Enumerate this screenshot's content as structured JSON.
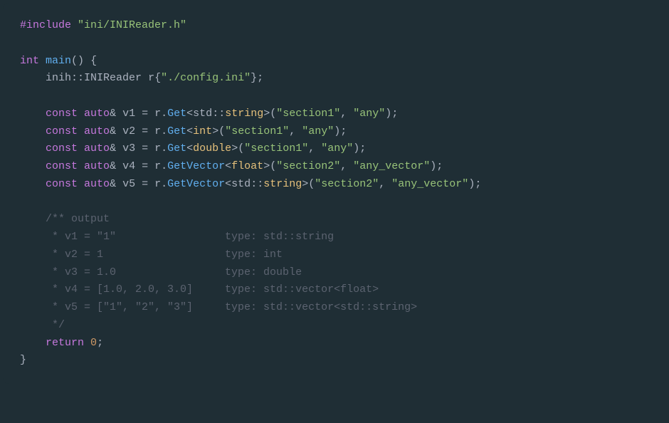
{
  "code": {
    "include_directive": "#include",
    "include_path": "\"ini/INIReader.h\"",
    "int_kw": "int",
    "main_fn": "main",
    "open_paren": "()",
    "open_brace": " {",
    "ns": "inih",
    "dbl_colon": "::",
    "reader_type": "INIReader",
    "reader_var": " r",
    "brace_open": "{",
    "config_path": "\"./config.ini\"",
    "brace_close": "}",
    "semi": ";",
    "const_kw": "const",
    "auto_kw": "auto",
    "amp": "&",
    "v1": " v1 ",
    "v2": " v2 ",
    "v3": " v3 ",
    "v4": " v4 ",
    "v5": " v5 ",
    "eq": "=",
    "r_obj": " r",
    "dot": ".",
    "get_fn": "Get",
    "getvec_fn": "GetVector",
    "lt": "<",
    "gt": ">",
    "std_ns": "std",
    "string_t": "string",
    "int_t": "int",
    "double_t": "double",
    "float_t": "float",
    "lparen": "(",
    "rparen": ")",
    "comma": ", ",
    "section1": "\"section1\"",
    "section2": "\"section2\"",
    "any": "\"any\"",
    "any_vector": "\"any_vector\"",
    "comment_block": "/** output\n     * v1 = \"1\"                 type: std::string\n     * v2 = 1                   type: int\n     * v3 = 1.0                 type: double\n     * v4 = [1.0, 2.0, 3.0]     type: std::vector<float>\n     * v5 = [\"1\", \"2\", \"3\"]     type: std::vector<std::string>\n     */",
    "return_kw": "return",
    "zero": "0",
    "close_brace": "}"
  }
}
